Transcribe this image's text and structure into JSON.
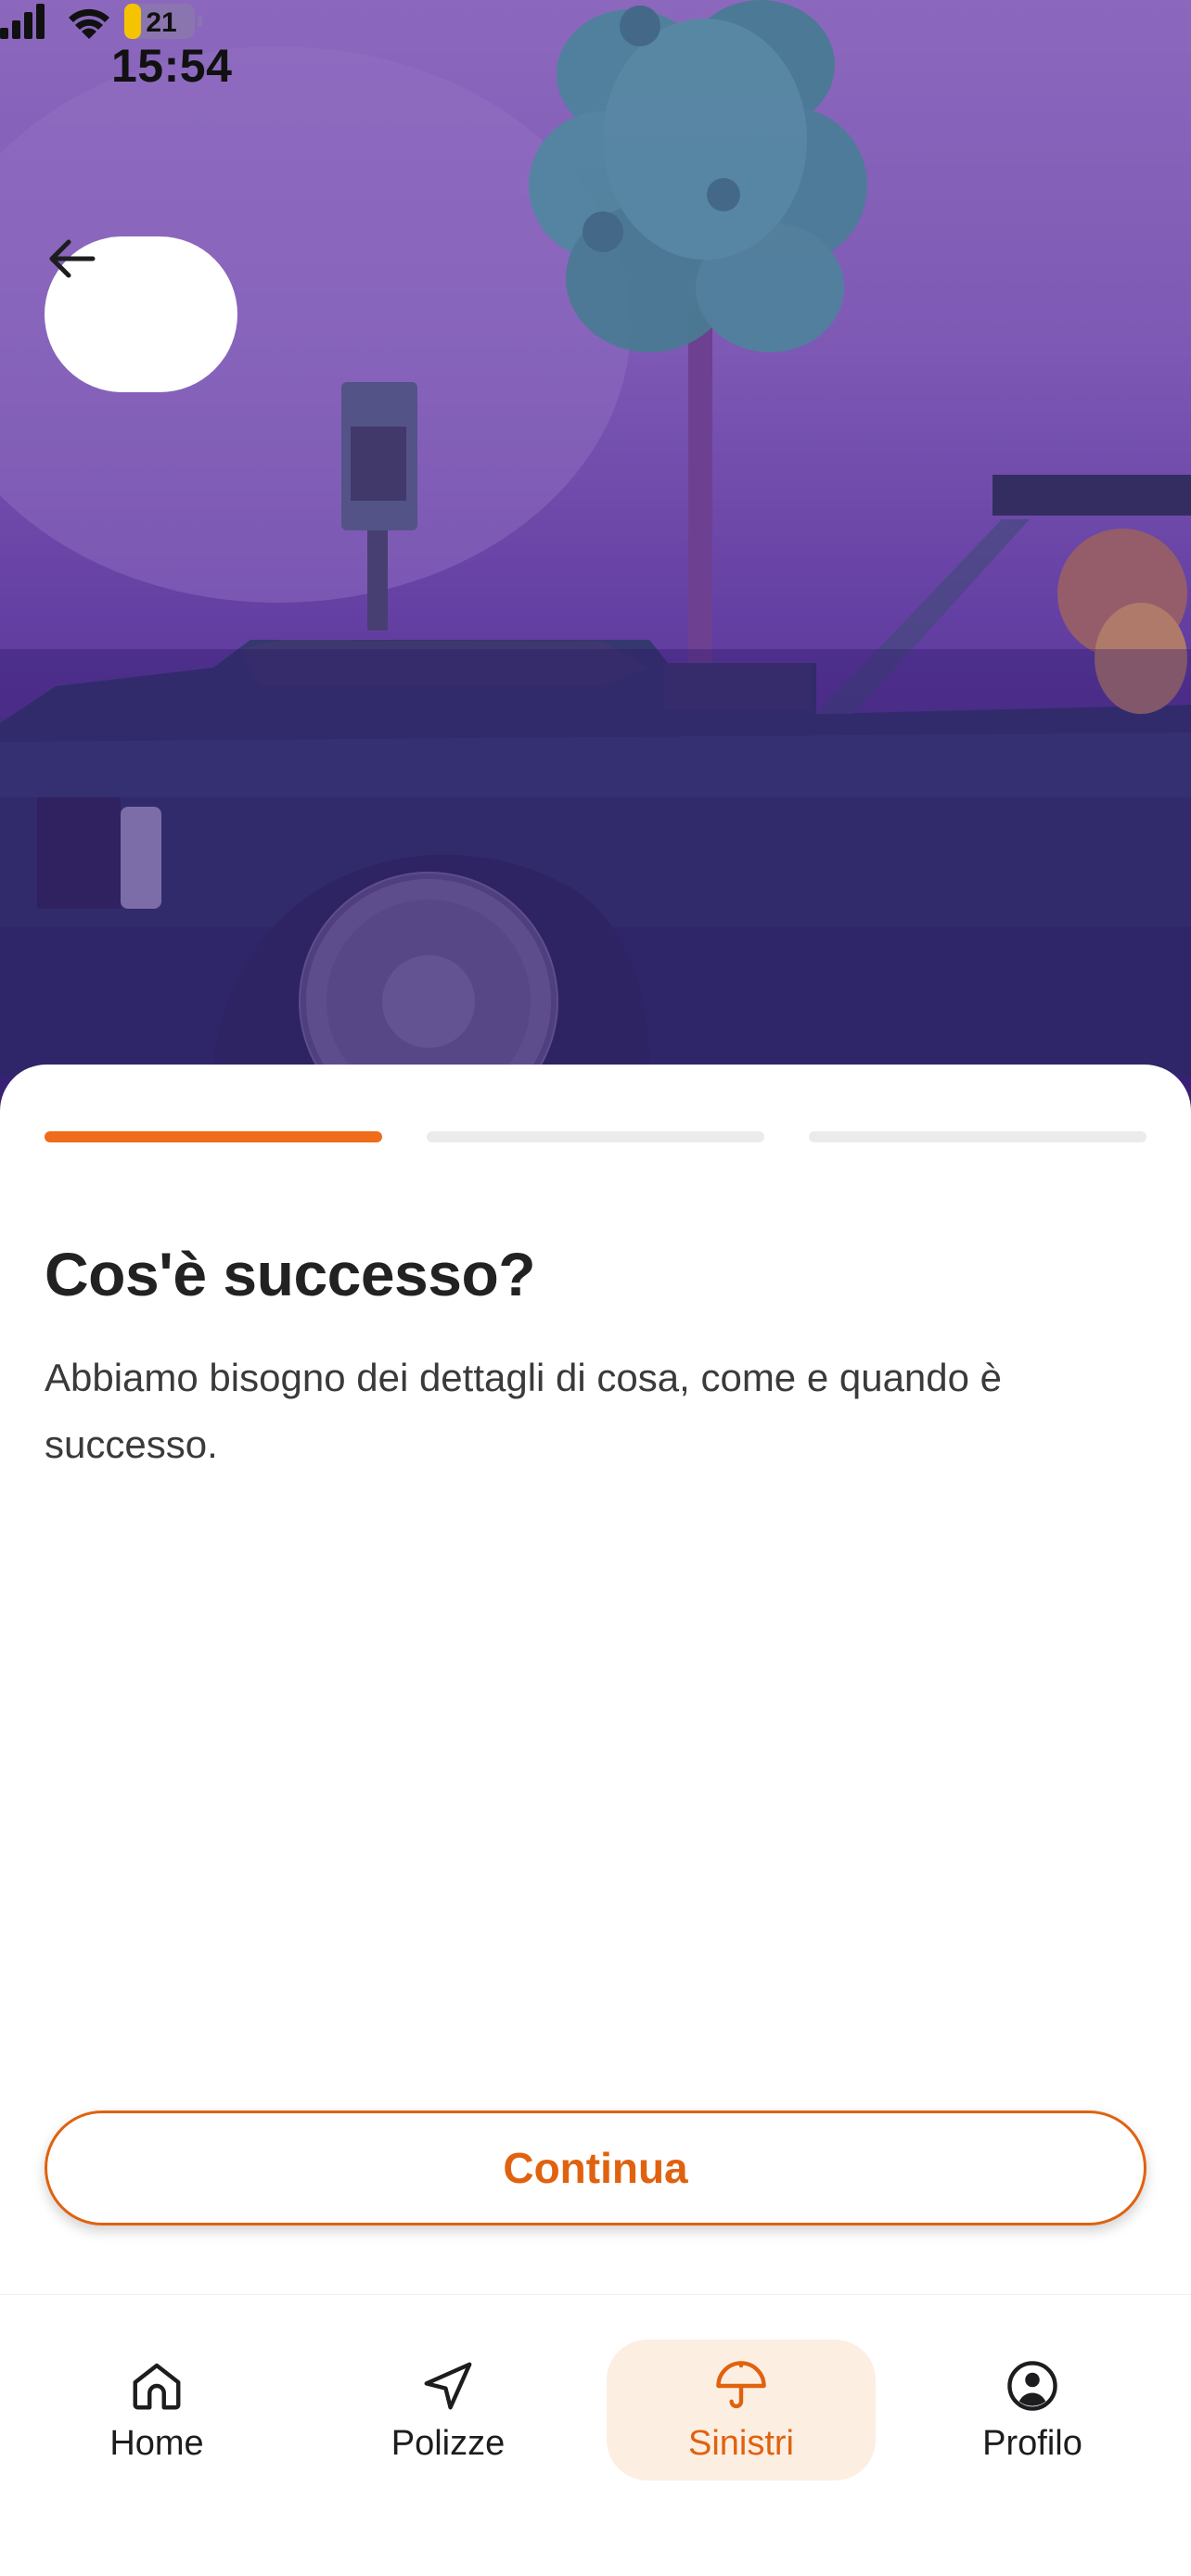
{
  "status_bar": {
    "time": "15:54",
    "battery_level": "21",
    "icons": [
      "signal-icon",
      "wifi-icon",
      "battery-icon"
    ]
  },
  "hero": {
    "image": "lego-car-photo",
    "back_icon": "arrow-left-icon"
  },
  "progress": {
    "steps_total": 3,
    "current_step": 1
  },
  "content": {
    "title": "Cos'è successo?",
    "subtitle": "Abbiamo bisogno dei dettagli di cosa, come e quando è successo."
  },
  "actions": {
    "continue_label": "Continua"
  },
  "tabbar": {
    "items": [
      {
        "label": "Home",
        "icon": "home-icon"
      },
      {
        "label": "Polizze",
        "icon": "navigation-arrow-icon"
      },
      {
        "label": "Sinistri",
        "icon": "umbrella-icon",
        "active": true
      },
      {
        "label": "Profilo",
        "icon": "user-circle-icon"
      }
    ]
  },
  "colors": {
    "accent": "#E0620F",
    "progress_active": "#EE6C1A",
    "progress_inactive": "#EBEBEB",
    "hero_overlay": "#6B4BA6",
    "tab_active_bg": "#FDEEE2"
  }
}
